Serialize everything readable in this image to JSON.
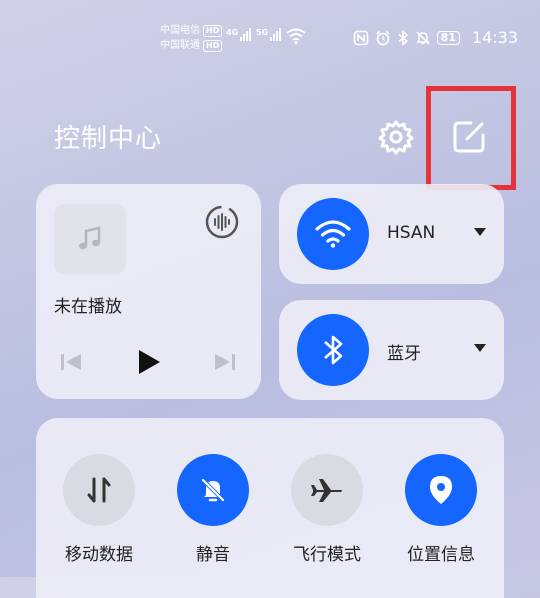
{
  "status_bar": {
    "carrier1": "中国电信",
    "carrier2": "中国联通",
    "hd_label": "HD",
    "net1": "4G",
    "net2": "5G",
    "battery": "81",
    "time": "14:33",
    "icons": [
      "nfc-icon",
      "alarm-icon",
      "bluetooth-icon",
      "mute-icon"
    ]
  },
  "header": {
    "title": "控制中心",
    "settings_icon": "gear-icon",
    "edit_icon": "edit-icon",
    "highlight_color": "#e5333a"
  },
  "media": {
    "status": "未在播放",
    "icons": [
      "music-note-icon",
      "audio-output-icon",
      "previous-icon",
      "play-icon",
      "next-icon"
    ]
  },
  "wifi": {
    "label": "HSAN",
    "icon": "wifi-icon"
  },
  "bluetooth": {
    "label": "蓝牙",
    "icon": "bluetooth-icon"
  },
  "toggles": [
    {
      "label": "移动数据",
      "icon": "mobile-data-icon",
      "active": false
    },
    {
      "label": "静音",
      "icon": "bell-off-icon",
      "active": true
    },
    {
      "label": "飞行模式",
      "icon": "airplane-icon",
      "active": false
    },
    {
      "label": "位置信息",
      "icon": "location-icon",
      "active": true
    }
  ],
  "colors": {
    "accent": "#1466ff",
    "card": "#ecedf6"
  }
}
